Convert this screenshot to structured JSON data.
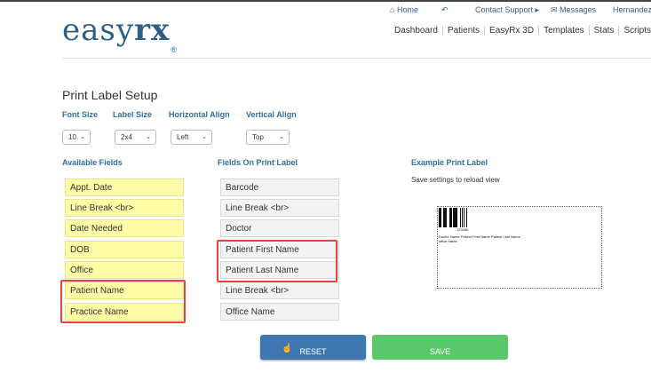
{
  "top_links": [
    {
      "icon": "home-icon",
      "glyph": "⌂",
      "label": "Home"
    },
    {
      "icon": "feedback-icon",
      "glyph": "↶",
      "label": ""
    },
    {
      "icon": "",
      "glyph": "",
      "label": "Contact Support ▸"
    },
    {
      "icon": "messages-icon",
      "glyph": "✉",
      "label": "Messages"
    },
    {
      "icon": "",
      "glyph": "",
      "label": "Hernandez"
    }
  ],
  "logo": {
    "light": "easy",
    "bold": "rx",
    "mark": "®"
  },
  "main_nav": [
    "Dashboard",
    "Patients",
    "EasyRx 3D",
    "Templates",
    "Stats",
    "Scripts"
  ],
  "page_title": "Print Label Setup",
  "settings": {
    "font_size": {
      "label": "Font Size",
      "value": "10"
    },
    "label_size": {
      "label": "Label Size",
      "value": "2x4"
    },
    "horizontal_align": {
      "label": "Horizontal Align",
      "value": "Left"
    },
    "vertical_align": {
      "label": "Vertical Align",
      "value": "Top"
    }
  },
  "available_fields": {
    "heading": "Available Fields",
    "items": [
      "Appt. Date",
      "Line Break <br>",
      "Date Needed",
      "DOB",
      "Office",
      "Patient Name",
      "Practice Name"
    ]
  },
  "label_fields": {
    "heading": "Fields On Print Label",
    "items": [
      "Barcode",
      "Line Break <br>",
      "Doctor",
      "Patient First Name",
      "Patient Last Name",
      "Line Break <br>",
      "Office Name"
    ]
  },
  "example": {
    "heading": "Example Print Label",
    "note": "Save settings to reload view",
    "barcode_number": "123456",
    "line1": "Doctor Name   Patient First Name   Patient Last Name",
    "line2": "office name"
  },
  "buttons": {
    "reset": "RESET",
    "save": "SAVE"
  },
  "colors": {
    "accent_blue": "#2f6f9f",
    "reset_button": "#3f78b0",
    "save_button": "#58c86b",
    "field_yellow": "#fffca8",
    "highlight_red": "#e8413f"
  }
}
